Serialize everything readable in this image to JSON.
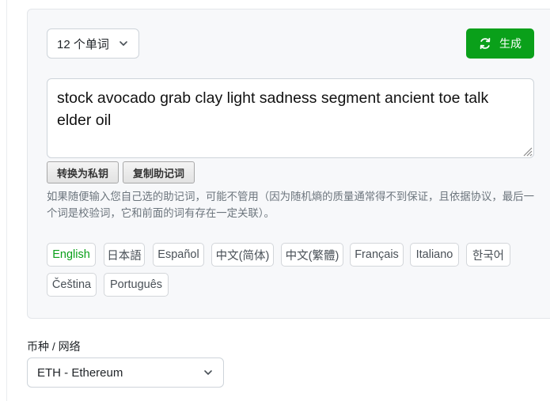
{
  "word_count_select": {
    "value": "12 个单词"
  },
  "generate_button": {
    "label": "生成",
    "color": "#0aa01a"
  },
  "mnemonic": {
    "text": "stock avocado grab clay light sadness segment ancient toe talk elder oil"
  },
  "actions": {
    "convert_label": "转换为私钥",
    "copy_label": "复制助记词"
  },
  "note": "如果随便输入您自己选的助记词，可能不管用（因为随机熵的质量通常得不到保证，且依据协议，最后一个词是校验词，它和前面的词有存在一定关联）。",
  "languages": {
    "active": "English",
    "items": [
      "English",
      "日本語",
      "Español",
      "中文(简体)",
      "中文(繁體)",
      "Français",
      "Italiano",
      "한국어",
      "Čeština",
      "Português"
    ]
  },
  "coin": {
    "label": "币种 / 网络",
    "value": "ETH - Ethereum"
  }
}
